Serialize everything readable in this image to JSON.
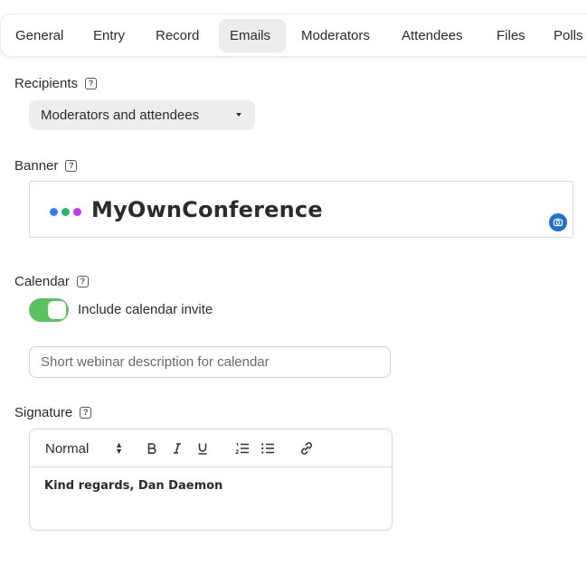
{
  "tabs": [
    {
      "label": "General"
    },
    {
      "label": "Entry"
    },
    {
      "label": "Record"
    },
    {
      "label": "Emails",
      "active": true
    },
    {
      "label": "Moderators"
    },
    {
      "label": "Attendees"
    },
    {
      "label": "Files"
    },
    {
      "label": "Polls"
    }
  ],
  "recipients": {
    "label": "Recipients",
    "help_symbol": "?",
    "selected": "Moderators and attendees"
  },
  "banner": {
    "label": "Banner",
    "help_symbol": "?",
    "logo_text": "MyOwnConference",
    "logo_dot_colors": [
      "#2f7ff0",
      "#22b573",
      "#c23bf0"
    ]
  },
  "calendar": {
    "label": "Calendar",
    "help_symbol": "?",
    "toggle_on": true,
    "toggle_label": "Include calendar invite",
    "description_placeholder": "Short webinar description for calendar",
    "description_value": ""
  },
  "signature": {
    "label": "Signature",
    "help_symbol": "?",
    "format_select": "Normal",
    "toolbar_icons": [
      "bold-icon",
      "italic-icon",
      "underline-icon",
      "ordered-list-icon",
      "bullet-list-icon",
      "link-icon"
    ],
    "content": "Kind regards, Dan Daemon"
  },
  "colors": {
    "toggle_on": "#5cc15f",
    "accent_blue": "#1f6fd1",
    "active_tab_bg": "#ececec"
  }
}
